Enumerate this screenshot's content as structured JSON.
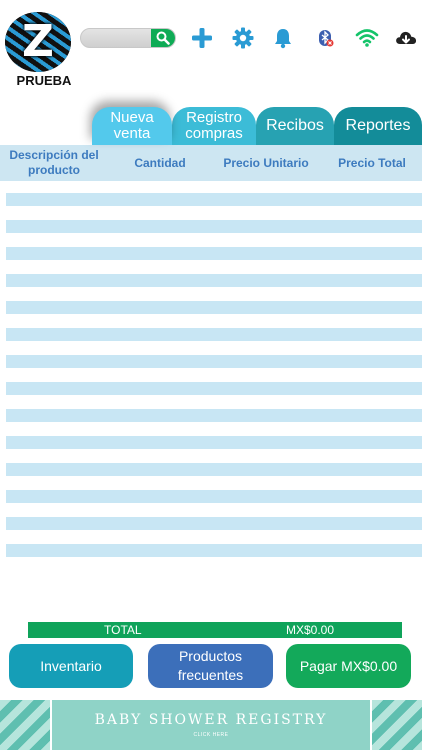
{
  "header": {
    "logo_letter": "Z",
    "logo_label": "PRUEBA",
    "search": {
      "value": "",
      "placeholder": ""
    },
    "icons": [
      "search-icon",
      "plus-icon",
      "gear-icon",
      "bell-icon",
      "bluetooth-off-icon",
      "wifi-icon",
      "cloud-download-icon"
    ],
    "colors": {
      "accent_blue": "#2a9bd4",
      "search_green": "#0eab55",
      "wifi_green": "#15c46a"
    }
  },
  "tabs": [
    {
      "label": "Nueva venta",
      "color": "#53c9ec",
      "active": true
    },
    {
      "label": "Registro compras",
      "color": "#3cbcd7",
      "active": false
    },
    {
      "label": "Recibos",
      "color": "#27a2b2",
      "active": false
    },
    {
      "label": "Reportes",
      "color": "#138c99",
      "active": false
    }
  ],
  "table": {
    "columns": [
      "Descripción del producto",
      "Cantidad",
      "Precio Unitario",
      "Precio Total"
    ],
    "rows": []
  },
  "totals": {
    "label": "TOTAL",
    "value": "MX$0.00"
  },
  "actions": {
    "inventory": "Inventario",
    "frequent": "Productos frecuentes",
    "pay": "Pagar MX$0.00"
  },
  "ad": {
    "title": "BABY SHOWER REGISTRY",
    "subtitle": "CLICK HERE"
  }
}
